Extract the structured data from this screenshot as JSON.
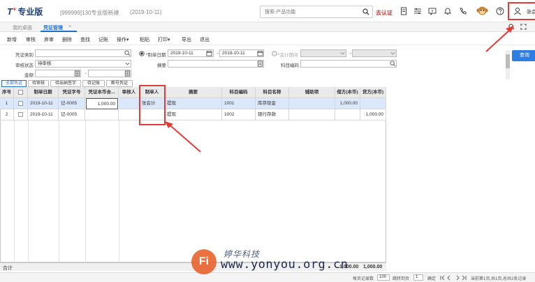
{
  "app": {
    "logo_text": "T",
    "logo_plus": "+",
    "logo_rest": "专业版",
    "account": "[999999]130专业版新建",
    "date": "(2019-10-11)",
    "search_placeholder": "搜索-产品功能",
    "cert_label": "去认证",
    "user_name": "张会"
  },
  "tabs": [
    {
      "label": "我的桌面"
    },
    {
      "label": "凭证管理"
    }
  ],
  "tab_close": "×",
  "toolbar": [
    "新增",
    "审核",
    "弃审",
    "删除",
    "查找",
    "记账",
    "操作▾",
    "粘贴",
    "打印▾",
    "导出",
    "退出"
  ],
  "filters": {
    "voucher_type_label": "凭证类别",
    "voucher_type_value": "",
    "audit_status_label": "审核状态",
    "audit_status_value": "待审核",
    "amount_label": "金额",
    "amount_from": "",
    "amount_to": "",
    "date_label": "*制单日期",
    "date_from": "2019-10-11",
    "date_to": "2019-10-11",
    "summary_label": "摘要",
    "summary_value": "",
    "period_label": "*会计期间",
    "subject_code_label": "科目编码",
    "subject_code_value": "",
    "range_sep": "-",
    "query_button": "查询"
  },
  "subtabs": [
    "全部凭证",
    "待审核",
    "待出纳签字",
    "待记账",
    "断号凭证"
  ],
  "grid": {
    "headers": [
      "序号",
      "",
      "制单日期",
      "凭证字号",
      "凭证本币合...",
      "审核人",
      "制单人",
      "摘要",
      "科目编码",
      "科目名称",
      "辅助项",
      "借方(本币)",
      "贷方(本币)"
    ],
    "rows": [
      {
        "no": "1",
        "date": "2019-10-11",
        "voucher_no": "记-0005",
        "amount": "1,000.00",
        "auditor": "",
        "maker": "张会计",
        "summary": "提现",
        "code": "1001",
        "name": "库存现金",
        "aux": "",
        "debit": "1,000.00",
        "credit": ""
      },
      {
        "no": "2",
        "date": "2019-10-11",
        "voucher_no": "记-0005",
        "amount": "",
        "auditor": "",
        "maker": "",
        "summary": "提现",
        "code": "1002",
        "name": "银行存款",
        "aux": "",
        "debit": "",
        "credit": "1,000.00"
      }
    ],
    "total_label": "合计",
    "total_debit": "1,000.00",
    "total_credit": "1,000.00"
  },
  "pager": {
    "records_label": "每页记录数",
    "records_value": "100",
    "jump_label": "跳转到页",
    "jump_value": "1",
    "confirm": "确定",
    "info": "当前第1页,共1页,总共2条记录"
  },
  "watermark": {
    "logo": "Fi",
    "cn": "婷华科技",
    "url": "www.yonyou.org.cn"
  },
  "colors": {
    "accent": "#1e6fd0",
    "annotation": "#e53935",
    "query_button": "#2e7de0"
  }
}
